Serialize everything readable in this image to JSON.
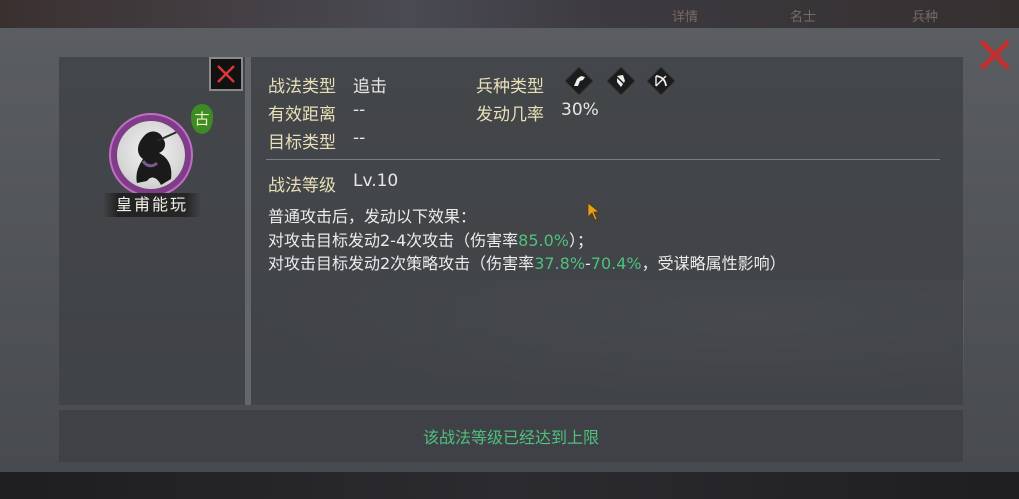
{
  "background": {
    "top_tabs": [
      "详情",
      "名士",
      "兵种"
    ]
  },
  "general": {
    "name": "皇甫能玩",
    "era_badge": "古"
  },
  "tactic": {
    "type_label": "战法类型",
    "type_value": "追击",
    "range_label": "有效距离",
    "range_value": "--",
    "target_label": "目标类型",
    "target_value": "--",
    "troop_label": "兵种类型",
    "troop_icons": [
      "cavalry-icon",
      "shield-icon",
      "bow-icon"
    ],
    "chance_label": "发动几率",
    "chance_value": "30%",
    "level_label": "战法等级",
    "level_value": "Lv.10"
  },
  "description": {
    "line1": "普通攻击后，发动以下效果：",
    "line2_prefix": "对攻击目标发动2-4次攻击（伤害率",
    "line2_value": "85.0%",
    "line2_suffix": "）；",
    "line3_prefix": "对攻击目标发动2次策略攻击（伤害率",
    "line3_value_a": "37.8%",
    "line3_dash": "-",
    "line3_value_b": "70.4%",
    "line3_suffix": "，受谋略属性影响）"
  },
  "footer": {
    "status": "该战法等级已经达到上限"
  },
  "colors": {
    "highlight": "#4fc07e",
    "label": "#e9dfb8",
    "close": "#c0302c"
  }
}
